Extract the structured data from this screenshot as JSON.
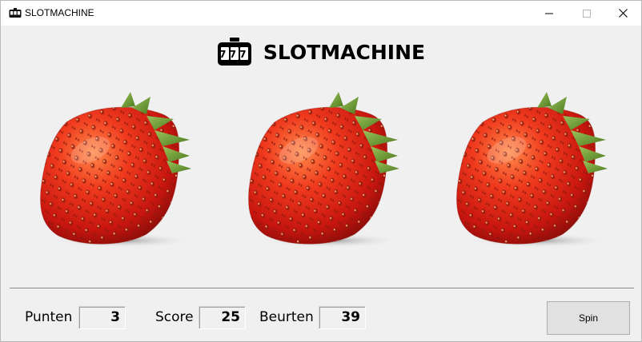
{
  "window": {
    "title": "SLOTMACHINE",
    "app_icon": "slot-machine-icon",
    "controls": [
      "minimize-icon",
      "maximize-icon",
      "close-icon"
    ]
  },
  "header": {
    "logo": "slot-machine-777-icon",
    "logo_text": "777",
    "title": "SLOTMACHINE"
  },
  "reels": [
    {
      "symbol": "strawberry"
    },
    {
      "symbol": "strawberry"
    },
    {
      "symbol": "strawberry"
    }
  ],
  "stats": {
    "punten": {
      "label": "Punten",
      "value": "3"
    },
    "score": {
      "label": "Score",
      "value": "25"
    },
    "beurten": {
      "label": "Beurten",
      "value": "39"
    }
  },
  "spin_button": {
    "label": "Spin"
  },
  "colors": {
    "window_bg": "#f0f0f0",
    "titlebar_bg": "#ffffff",
    "strawberry_red": "#d8261b",
    "leaf_green": "#5f8f2a"
  }
}
